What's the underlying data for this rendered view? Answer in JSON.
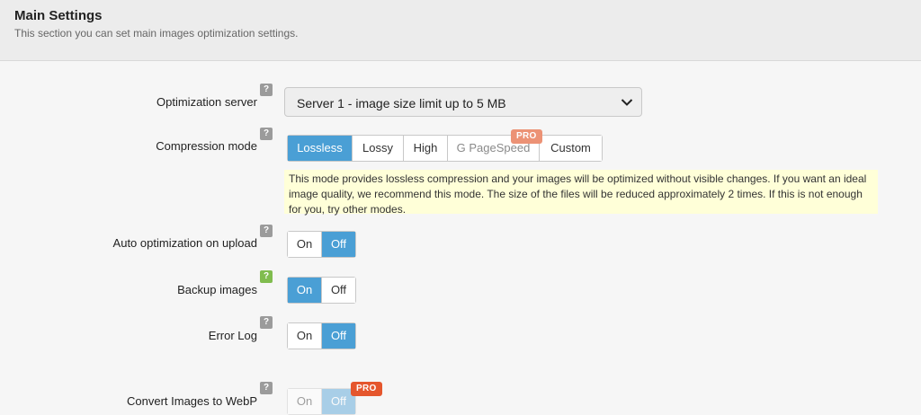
{
  "header": {
    "title": "Main Settings",
    "subtitle": "This section you can set main images optimization settings."
  },
  "help_glyph": "?",
  "server": {
    "label": "Optimization server",
    "value": "Server 1 - image size limit up to 5 MB"
  },
  "compression": {
    "label": "Compression mode",
    "options": [
      "Lossless",
      "Lossy",
      "High",
      "G PageSpeed",
      "Custom"
    ],
    "selected": "Lossless",
    "pro_badge": "PRO",
    "notice": "This mode provides lossless compression and your images will be optimized without visible changes. If you want an ideal image quality, we recommend this mode. The size of the files will be reduced approximately 2 times. If this is not enough for you, try other modes."
  },
  "auto_optimization": {
    "label": "Auto optimization on upload",
    "on": "On",
    "off": "Off",
    "value": "Off"
  },
  "backup": {
    "label": "Backup images",
    "on": "On",
    "off": "Off",
    "value": "On"
  },
  "error_log": {
    "label": "Error Log",
    "on": "On",
    "off": "Off",
    "value": "Off"
  },
  "webp": {
    "label": "Convert Images to WebP",
    "on": "On",
    "off": "Off",
    "value": "Off",
    "pro_badge": "PRO"
  },
  "colors": {
    "accent": "#4a9fd5",
    "pro_soft": "#ec9275",
    "pro_strong": "#e5562d",
    "notice_bg": "#ffffd8",
    "help_green": "#80bc4e"
  }
}
